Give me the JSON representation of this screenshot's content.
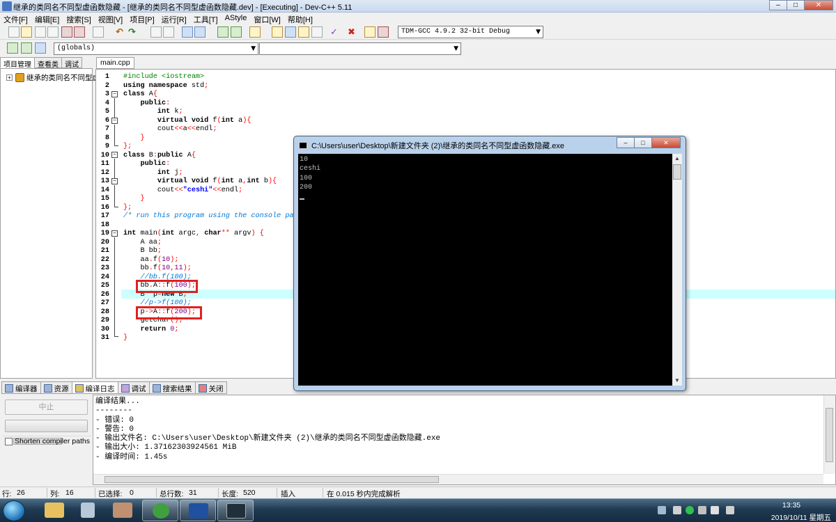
{
  "window": {
    "title": "继承的类同名不同型虚函数隐藏 - [继承的类同名不同型虚函数隐藏.dev] - [Executing] - Dev-C++ 5.11"
  },
  "menu": [
    "文件[F]",
    "编辑[E]",
    "搜索[S]",
    "视图[V]",
    "项目[P]",
    "运行[R]",
    "工具[T]",
    "AStyle",
    "窗口[W]",
    "帮助[H]"
  ],
  "toolbar": {
    "compiler_select": "TDM-GCC 4.9.2 32-bit Debug",
    "scope_select": "(globals)",
    "member_select": ""
  },
  "left_panel": {
    "tabs": [
      "项目管理",
      "查看类",
      "调试"
    ],
    "tree_item": "继承的类同名不同型虚函数隐藏"
  },
  "editor": {
    "tab": "main.cpp",
    "line_numbers": [
      "1",
      "2",
      "3",
      "4",
      "5",
      "6",
      "7",
      "8",
      "9",
      "10",
      "11",
      "12",
      "13",
      "14",
      "15",
      "16",
      "17",
      "18",
      "19",
      "20",
      "21",
      "22",
      "23",
      "24",
      "25",
      "26",
      "27",
      "28",
      "29",
      "30",
      "31"
    ]
  },
  "console": {
    "title": "C:\\Users\\user\\Desktop\\新建文件夹 (2)\\继承的类同名不同型虚函数隐藏.exe",
    "output": "10\nceshi\n100\n200"
  },
  "bottom_panel": {
    "tabs": [
      "编译器",
      "资源",
      "编译日志",
      "调试",
      "搜索结果",
      "关闭"
    ],
    "stop_button": "中止",
    "shorten_paths": "Shorten compiler paths",
    "log": "编译结果...\n--------\n- 错误: 0\n- 警告: 0\n- 输出文件名: C:\\Users\\user\\Desktop\\新建文件夹 (2)\\继承的类同名不同型虚函数隐藏.exe\n- 输出大小: 1.37162303924561 MiB\n- 编译时间: 1.45s"
  },
  "statusbar": {
    "row_label": "行:",
    "row_value": "26",
    "col_label": "列:",
    "col_value": "16",
    "selected_label": "已选择:",
    "selected_value": "0",
    "total_label": "总行数:",
    "total_value": "31",
    "length_label": "长度:",
    "length_value": "520",
    "mode": "插入",
    "parse_info": "在 0.015 秒内完成解析"
  },
  "taskbar": {
    "time": "13:35",
    "date": "2019/10/11 星期五"
  }
}
